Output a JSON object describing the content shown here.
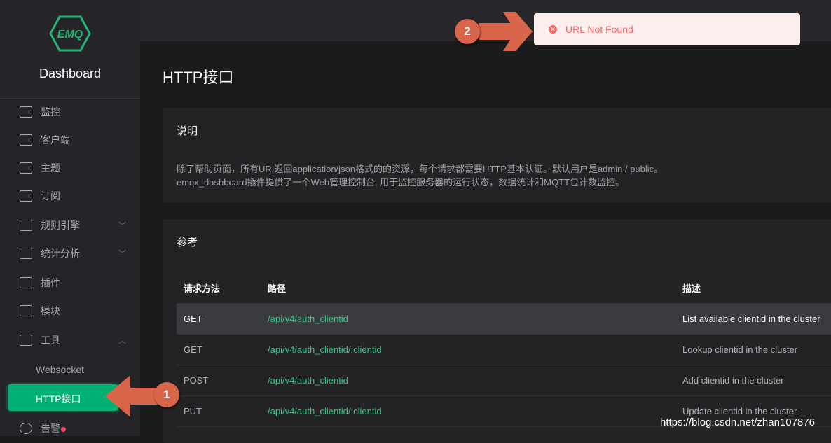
{
  "sidebar": {
    "logo_text": "EMQ",
    "brand": "Dashboard",
    "items": [
      {
        "label": "监控"
      },
      {
        "label": "客户端"
      },
      {
        "label": "主题"
      },
      {
        "label": "订阅"
      },
      {
        "label": "规则引擎"
      },
      {
        "label": "统计分析"
      },
      {
        "label": "插件"
      },
      {
        "label": "模块"
      },
      {
        "label": "工具"
      }
    ],
    "sub_items": [
      {
        "label": "Websocket"
      },
      {
        "label": "HTTP接口"
      }
    ],
    "alarm": "告警"
  },
  "page": {
    "title": "HTTP接口"
  },
  "intro": {
    "heading": "说明",
    "lines": [
      "除了帮助页面，所有URI返回application/json格式的的资源，每个请求都需要HTTP基本认证。默认用户是admin / public。",
      "emqx_dashboard插件提供了一个Web管理控制台, 用于监控服务器的运行状态，数据统计和MQTT包计数监控。"
    ]
  },
  "reference": {
    "heading": "参考",
    "columns": [
      "请求方法",
      "路径",
      "描述"
    ],
    "rows": [
      {
        "method": "GET",
        "path": "/api/v4/auth_clientid",
        "desc": "List available clientid in the cluster"
      },
      {
        "method": "GET",
        "path": "/api/v4/auth_clientid/:clientid",
        "desc": "Lookup clientid in the cluster"
      },
      {
        "method": "POST",
        "path": "/api/v4/auth_clientid",
        "desc": "Add clientid in the cluster"
      },
      {
        "method": "PUT",
        "path": "/api/v4/auth_clientid/:clientid",
        "desc": "Update clientid in the cluster"
      }
    ]
  },
  "toast": {
    "message": "URL Not Found"
  },
  "annotations": [
    "1",
    "2"
  ],
  "watermark": "https://blog.csdn.net/zhan107876"
}
